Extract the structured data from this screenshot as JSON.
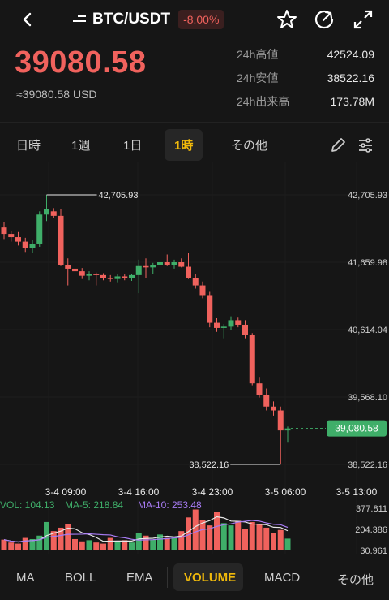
{
  "header": {
    "pair": "BTC/USDT",
    "change": "-8.00%"
  },
  "price": {
    "last": "39080.58",
    "usd": "≈39080.58 USD"
  },
  "stats": [
    {
      "label": "24h高値",
      "value": "42524.09"
    },
    {
      "label": "24h安値",
      "value": "38522.16"
    },
    {
      "label": "24h出来高",
      "value": "173.78M"
    }
  ],
  "timeframes": [
    "日時",
    "1週",
    "1日",
    "1時",
    "その他"
  ],
  "active_timeframe": "1時",
  "colors": {
    "up": "#3fae69",
    "down": "#f0625d",
    "accent": "#f0b90b",
    "ma5": "#e6e6e6",
    "ma10": "#a77bf3"
  },
  "chart_data": {
    "type": "candlestick",
    "y_axis_labels": [
      "42,705.93",
      "41,659.98",
      "40,614.04",
      "39,568.10",
      "38,522.16"
    ],
    "x_axis_labels": [
      "3-4 09:00",
      "3-4 16:00",
      "3-4 23:00",
      "3-5 06:00",
      "3-5 13:00"
    ],
    "high_label": "42,705.93",
    "low_label": "38,522.16",
    "last_price_label": "39,080.58",
    "ylim": [
      38522.16,
      42705.93
    ],
    "candles": [
      {
        "o": 42200,
        "h": 42280,
        "l": 42020,
        "c": 42100
      },
      {
        "o": 42100,
        "h": 42150,
        "l": 41980,
        "c": 42050
      },
      {
        "o": 42050,
        "h": 42130,
        "l": 41920,
        "c": 41980
      },
      {
        "o": 41980,
        "h": 42040,
        "l": 41820,
        "c": 41880
      },
      {
        "o": 41880,
        "h": 42000,
        "l": 41800,
        "c": 41950
      },
      {
        "o": 41950,
        "h": 42450,
        "l": 41900,
        "c": 42400
      },
      {
        "o": 42400,
        "h": 42705.93,
        "l": 42300,
        "c": 42480
      },
      {
        "o": 42450,
        "h": 42500,
        "l": 42350,
        "c": 42380
      },
      {
        "o": 42380,
        "h": 42480,
        "l": 41600,
        "c": 41620
      },
      {
        "o": 41620,
        "h": 41720,
        "l": 41300,
        "c": 41560
      },
      {
        "o": 41560,
        "h": 41600,
        "l": 41480,
        "c": 41520
      },
      {
        "o": 41520,
        "h": 41570,
        "l": 41400,
        "c": 41450
      },
      {
        "o": 41450,
        "h": 41520,
        "l": 41380,
        "c": 41480
      },
      {
        "o": 41480,
        "h": 41500,
        "l": 41300,
        "c": 41460
      },
      {
        "o": 41460,
        "h": 41490,
        "l": 41380,
        "c": 41420
      },
      {
        "o": 41420,
        "h": 41460,
        "l": 41360,
        "c": 41400
      },
      {
        "o": 41400,
        "h": 41470,
        "l": 41350,
        "c": 41440
      },
      {
        "o": 41440,
        "h": 41470,
        "l": 41380,
        "c": 41410
      },
      {
        "o": 41410,
        "h": 41480,
        "l": 41370,
        "c": 41460
      },
      {
        "o": 41460,
        "h": 41700,
        "l": 41180,
        "c": 41600
      },
      {
        "o": 41600,
        "h": 41720,
        "l": 41420,
        "c": 41580
      },
      {
        "o": 41580,
        "h": 41650,
        "l": 41480,
        "c": 41610
      },
      {
        "o": 41610,
        "h": 41700,
        "l": 41550,
        "c": 41660
      },
      {
        "o": 41660,
        "h": 41780,
        "l": 41600,
        "c": 41620
      },
      {
        "o": 41620,
        "h": 41700,
        "l": 41560,
        "c": 41660
      },
      {
        "o": 41660,
        "h": 41720,
        "l": 41580,
        "c": 41590
      },
      {
        "o": 41590,
        "h": 41800,
        "l": 41400,
        "c": 41420
      },
      {
        "o": 41420,
        "h": 41480,
        "l": 41250,
        "c": 41300
      },
      {
        "o": 41300,
        "h": 41360,
        "l": 41100,
        "c": 41150
      },
      {
        "o": 41150,
        "h": 41200,
        "l": 40650,
        "c": 40720
      },
      {
        "o": 40720,
        "h": 40790,
        "l": 40580,
        "c": 40640
      },
      {
        "o": 40640,
        "h": 40700,
        "l": 40480,
        "c": 40660
      },
      {
        "o": 40660,
        "h": 40820,
        "l": 40610,
        "c": 40760
      },
      {
        "o": 40760,
        "h": 40800,
        "l": 40650,
        "c": 40690
      },
      {
        "o": 40690,
        "h": 40760,
        "l": 40480,
        "c": 40530
      },
      {
        "o": 40530,
        "h": 40560,
        "l": 39750,
        "c": 39780
      },
      {
        "o": 39780,
        "h": 39880,
        "l": 39560,
        "c": 39600
      },
      {
        "o": 39600,
        "h": 39700,
        "l": 39360,
        "c": 39420
      },
      {
        "o": 39420,
        "h": 39500,
        "l": 39280,
        "c": 39360
      },
      {
        "o": 39360,
        "h": 39420,
        "l": 38522.16,
        "c": 39050
      },
      {
        "o": 39050,
        "h": 39110,
        "l": 38860,
        "c": 39080.58
      }
    ],
    "volume": {
      "labels": [
        "377.811",
        "204.386",
        "30.961"
      ],
      "vol": "VOL: 104.13",
      "ma5": "MA-5: 218.84",
      "ma10": "MA-10: 253.48",
      "values": [
        95,
        70,
        60,
        110,
        100,
        130,
        250,
        170,
        200,
        230,
        100,
        80,
        90,
        70,
        60,
        110,
        85,
        90,
        70,
        150,
        130,
        95,
        140,
        110,
        120,
        170,
        290,
        360,
        270,
        220,
        340,
        240,
        220,
        260,
        190,
        250,
        230,
        200,
        150,
        180,
        104.13
      ]
    }
  },
  "indicators": [
    "MA",
    "BOLL",
    "EMA",
    "VOLUME",
    "MACD",
    "その他"
  ],
  "active_indicator": "VOLUME"
}
